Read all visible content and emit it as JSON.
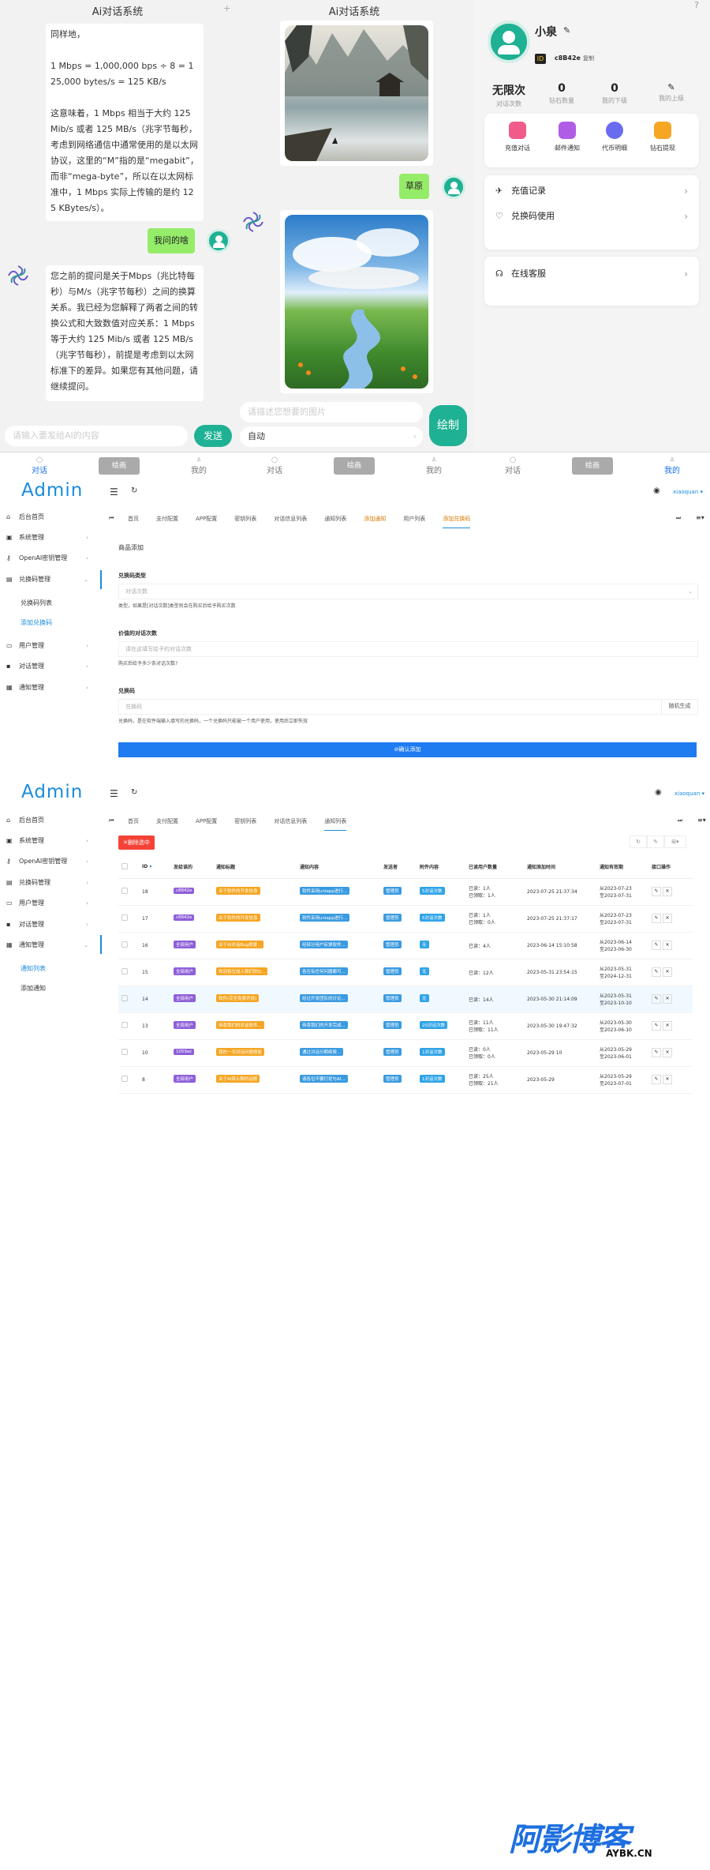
{
  "chat": {
    "title": "Ai对话系统",
    "plus": "+",
    "ai_reply_1": "同样地，\n\n1 Mbps = 1,000,000 bps ÷ 8 = 125,000 bytes/s = 125 KB/s\n\n这意味着，1 Mbps 相当于大约 125 Mib/s 或者 125 MB/s（兆字节每秒，考虑到网络通信中通常使用的是以太网协议，这里的“M”指的是“megabit”，而非“mega-byte”，所以在以太网标准中，1 Mbps 实际上传输的是约 125 KBytes/s）。",
    "user_msg_1": "我问的啥",
    "ai_reply_2": "您之前的提问是关于Mbps（兆比特每秒）与M/s（兆字节每秒）之间的换算关系。我已经为您解释了两者之间的转换公式和大致数值对应关系：1 Mbps 等于大约 125 Mib/s 或者 125 MB/s（兆字节每秒），前提是考虑到以太网标准下的差异。如果您有其他问题，请继续提问。",
    "input_placeholder": "请输入要发给AI的内容",
    "send_label": "发送"
  },
  "draw": {
    "title": "Ai对话系统",
    "user_msg": "草原",
    "prompt_placeholder": "请描述您想要的图片",
    "mode_value": "自动",
    "draw_button": "绘制"
  },
  "profile": {
    "help": "?",
    "name": "小泉",
    "id_badge": "ID",
    "id_value": "c8B42e",
    "copy_label": "复制",
    "stats": [
      {
        "value": "无限次",
        "label": "对话次数"
      },
      {
        "value": "0",
        "label": "钻石数量"
      },
      {
        "value": "0",
        "label": "我的下级"
      },
      {
        "value": "",
        "label": "我的上级"
      }
    ],
    "quick": [
      {
        "label": "充值对话",
        "color": "#f05b8a"
      },
      {
        "label": "邮件通知",
        "color": "#b15ce6"
      },
      {
        "label": "代币明细",
        "color": "#6a6cf0"
      },
      {
        "label": "钻石提现",
        "color": "#f5a623"
      }
    ],
    "menu1": [
      {
        "label": "充值记录",
        "icon": "✈"
      },
      {
        "label": "兑换码使用",
        "icon": "♡"
      }
    ],
    "service": {
      "label": "在线客服",
      "icon": "☊"
    }
  },
  "tabbar": {
    "tabs": [
      "对话",
      "绘画",
      "我的",
      "对话",
      "绘画",
      "我的",
      "对话",
      "绘画",
      "我的"
    ]
  },
  "admin1": {
    "logo": "Admin",
    "user": "xiaoquan",
    "sidebar": [
      "后台首页",
      "系统管理",
      "OpenAI密钥管理",
      "兑换码管理",
      "兑换码列表",
      "添加兑换码",
      "用户管理",
      "对话管理",
      "通知管理"
    ],
    "tabs": [
      "首页",
      "支付配置",
      "APP配置",
      "密钥列表",
      "对话信息列表",
      "通知列表",
      "添加通知",
      "用户列表",
      "添加兑换码"
    ],
    "section": "商品添加",
    "type_label": "兑换码类型",
    "type_value": "对话次数",
    "type_hint": "类型，如果是[对话次数]类型则会在购买后给予购买次数",
    "count_label": "价值的对话次数",
    "count_placeholder": "请在这填写给予的对话次数",
    "count_hint": "购买后给予多少条对话次数?",
    "code_label": "兑换码",
    "code_placeholder": "兑换码",
    "code_random": "随机生成",
    "code_hint": "兑换码，是在软件端输入填写的兑换码，一个兑换码只能被一个用户使用，使用后立即失效",
    "submit": "⊘确认添加"
  },
  "admin2": {
    "logo": "Admin",
    "user": "xiaoquan",
    "sidebar": [
      "后台首页",
      "系统管理",
      "OpenAI密钥管理",
      "兑换码管理",
      "用户管理",
      "对话管理",
      "通知管理",
      "通知列表",
      "添加通知"
    ],
    "tabs": [
      "首页",
      "支付配置",
      "APP配置",
      "密钥列表",
      "对话信息列表",
      "通知列表"
    ],
    "delete_btn": "✕删除选中",
    "headers": [
      "ID",
      "发给谁的",
      "通知标题",
      "通知内容",
      "发送者",
      "附件内容",
      "已读用户数量",
      "通知添加时间",
      "通知有效期",
      "接口操作"
    ],
    "rows": [
      {
        "id": "18",
        "to": "c8842e",
        "to_c": "t-p",
        "title": "关于软件的开发信息",
        "content": "软件采用uniapp进行...",
        "sender": "管理员",
        "att": "5对话次数",
        "att_c": "t-c",
        "read": "已读：1人\n已领取：1人",
        "time": "2023-07-25 21:37:34",
        "valid": "从2023-07-23\n至2023-07-31"
      },
      {
        "id": "17",
        "to": "c8842e",
        "to_c": "t-p",
        "title": "关于软件的开发信息",
        "content": "软件采用uniapp进行...",
        "sender": "管理员",
        "att": "5对话次数",
        "att_c": "t-c",
        "read": "已读：1人\n已领取：0人",
        "time": "2023-07-25 21:37:17",
        "valid": "从2023-07-23\n至2023-07-31"
      },
      {
        "id": "16",
        "to": "全部用户",
        "to_c": "t-p",
        "title": "关于AI对话Bug修复...",
        "content": "经部分用户反馈软件...",
        "sender": "管理员",
        "att": "无",
        "att_c": "t-c",
        "read": "已读：4人",
        "time": "2023-06-14 15:10:58",
        "valid": "从2023-06-14\n至2023-06-30"
      },
      {
        "id": "15",
        "to": "全部用户",
        "to_c": "t-p",
        "title": "欢迎各位加入我们的Q...",
        "content": "各位有任何问题都可...",
        "sender": "管理员",
        "att": "无",
        "att_c": "t-c",
        "read": "已读：12人",
        "time": "2023-05-31 23:54:15",
        "valid": "从2023-05-31\n至2024-12-31"
      },
      {
        "id": "14",
        "to": "全部用户",
        "to_c": "t-p",
        "title": "软件(完全免费开放)",
        "content": "经过开发团队的讨论...",
        "sender": "管理员",
        "att": "无",
        "att_c": "t-c",
        "read": "已读：14人",
        "time": "2023-05-30 21:14:09",
        "valid": "从2023-05-31\n至2023-10-10"
      },
      {
        "id": "13",
        "to": "全部用户",
        "to_c": "t-p",
        "title": "恭喜我们的对话软件...",
        "content": "恭喜我们的开发完成...",
        "sender": "管理员",
        "att": "20对话次数",
        "att_c": "t-c",
        "read": "已读：11人\n已领取：11人",
        "time": "2023-05-30 19:47:32",
        "valid": "从2023-05-30\n至2023-06-10"
      },
      {
        "id": "10",
        "to": "1059ac",
        "to_c": "t-p",
        "title": "我的一次对话问题修复",
        "content": "通过对话分期续费...",
        "sender": "管理员",
        "att": "1对话次数",
        "att_c": "t-c",
        "read": "已读：0人\n已领取：0人",
        "time": "2023-05-29 10",
        "valid": "从2023-05-29\n至2023-06-01"
      },
      {
        "id": "8",
        "to": "全部用户",
        "to_c": "t-p",
        "title": "关于AI禁止聊的话题",
        "content": "请各位不要打扰与AI...",
        "sender": "管理员",
        "att": "1对话次数",
        "att_c": "t-c",
        "read": "已读：25人\n已领取：21人",
        "time": "2023-05-29",
        "valid": "从2023-05-29\n至2023-07-01"
      }
    ]
  },
  "watermark": {
    "big": "阿影博客",
    "small": "AYBK.CN"
  }
}
